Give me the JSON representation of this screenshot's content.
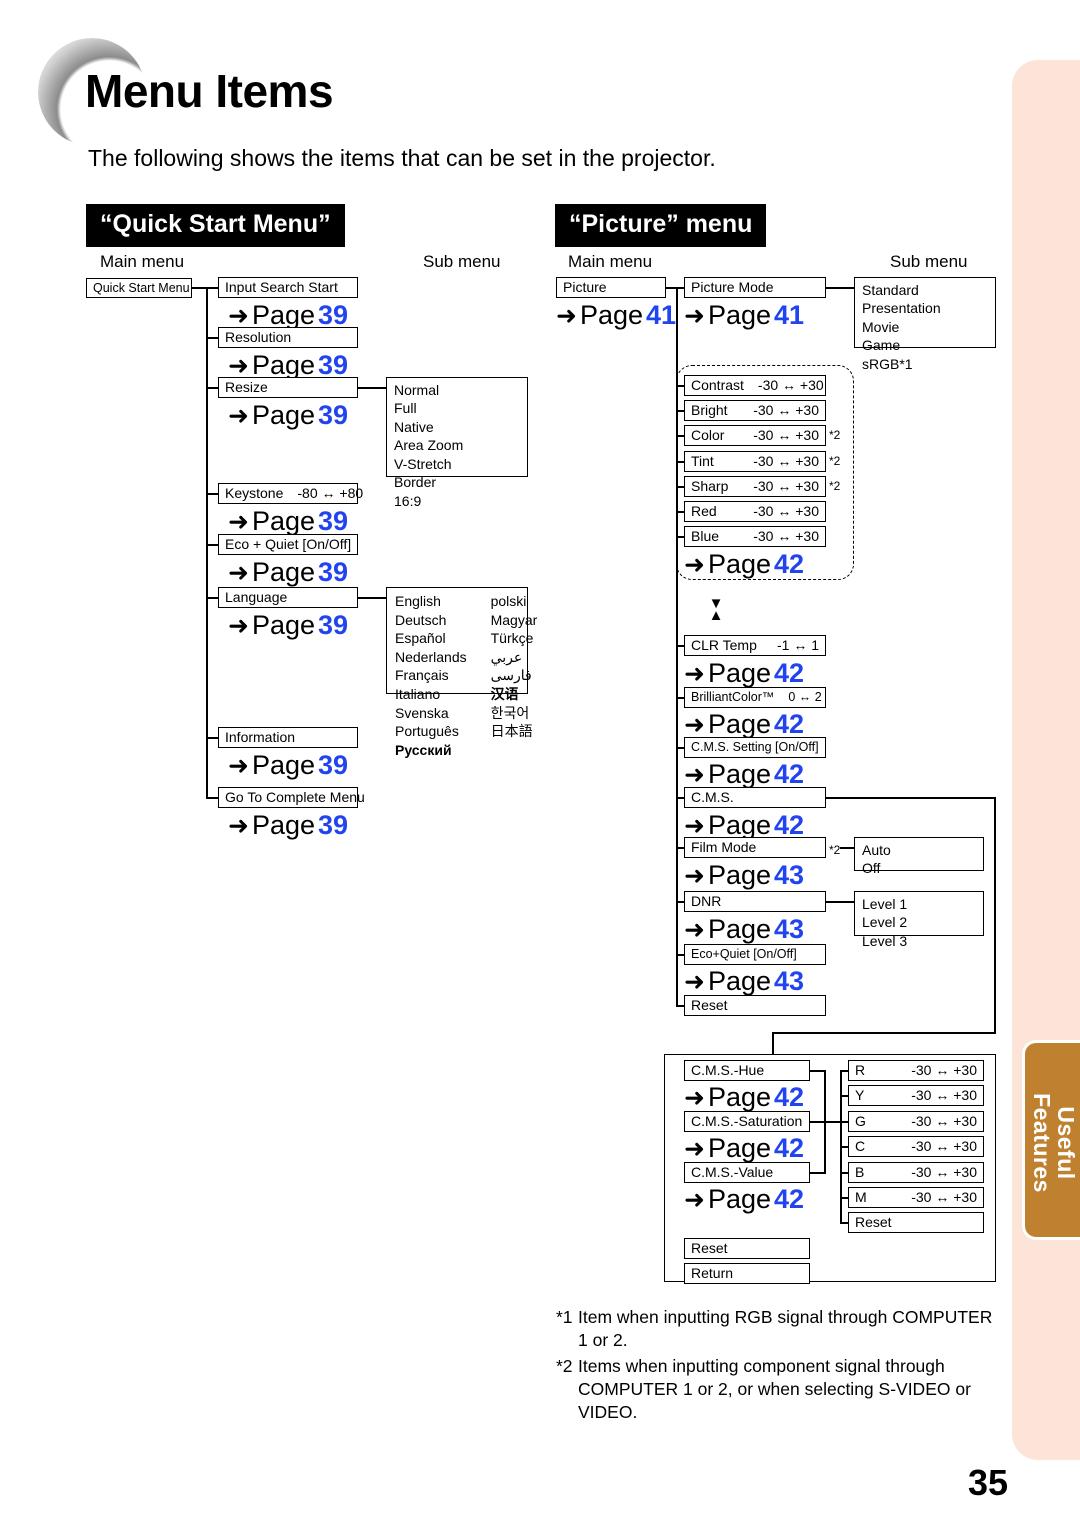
{
  "page": {
    "title": "Menu Items",
    "intro": "The following shows the items that can be set in the projector.",
    "number": "35",
    "side_tab": "Useful\nFeatures",
    "accent_blue": "#2244ee",
    "tab_color": "#bf8130",
    "panel_color": "#fce4d8"
  },
  "labels": {
    "main_menu": "Main menu",
    "sub_menu": "Sub menu",
    "arrow": "➜",
    "page_word": "Page",
    "range_arrow": "↔",
    "scroll_down": "▼",
    "scroll_up": "▲"
  },
  "quick_start": {
    "banner": "“Quick Start Menu”",
    "root": "Quick Start Menu",
    "root_page": "",
    "items": [
      {
        "label": "Input Search Start",
        "page": "39"
      },
      {
        "label": "Resolution",
        "page": "39"
      },
      {
        "label": "Resize",
        "page": "39"
      },
      {
        "label": "Keystone",
        "range": "-80 ↔ +80",
        "page": "39"
      },
      {
        "label": "Eco + Quiet [On/Off]",
        "page": "39"
      },
      {
        "label": "Language",
        "page": "39"
      },
      {
        "label": "Information",
        "page": "39"
      },
      {
        "label": "Go To Complete Menu",
        "page": "39"
      }
    ],
    "resize_options": [
      "Normal",
      "Full",
      "Native",
      "Area Zoom",
      "V-Stretch",
      "Border",
      "16:9"
    ],
    "language_options_left": [
      "English",
      "Deutsch",
      "Español",
      "Nederlands",
      "Français",
      "Italiano",
      "Svenska",
      "Português",
      "Русский"
    ],
    "language_options_right": [
      "polski",
      "Magyar",
      "Türkçe",
      "عربي",
      "فارسی",
      "汉语",
      "한국어",
      "日本語"
    ]
  },
  "picture": {
    "banner": "“Picture” menu",
    "root": "Picture",
    "root_page": "41",
    "picture_mode": {
      "label": "Picture Mode",
      "page": "41"
    },
    "picture_mode_options": [
      "Standard",
      "Presentation",
      "Movie",
      "Game",
      "sRGB*1"
    ],
    "adjust_group": {
      "page": "42",
      "items": [
        {
          "label": "Contrast",
          "range": "-30 ↔ +30",
          "note": ""
        },
        {
          "label": "Bright",
          "range": "-30 ↔ +30",
          "note": ""
        },
        {
          "label": "Color",
          "range": "-30 ↔ +30",
          "note": "*2"
        },
        {
          "label": "Tint",
          "range": "-30 ↔ +30",
          "note": "*2"
        },
        {
          "label": "Sharp",
          "range": "-30 ↔ +30",
          "note": "*2"
        },
        {
          "label": "Red",
          "range": "-30 ↔ +30",
          "note": ""
        },
        {
          "label": "Blue",
          "range": "-30 ↔ +30",
          "note": ""
        }
      ]
    },
    "lower_items": [
      {
        "label": "CLR Temp",
        "range": "-1 ↔ 1",
        "page": "42"
      },
      {
        "label": "BrilliantColor™",
        "range": "0 ↔ 2",
        "page": "42"
      },
      {
        "label": "C.M.S. Setting [On/Off]",
        "range": "",
        "page": "42"
      },
      {
        "label": "C.M.S.",
        "range": "",
        "page": "42"
      },
      {
        "label": "Film Mode",
        "range": "",
        "page": "43",
        "note": "*2"
      },
      {
        "label": "DNR",
        "range": "",
        "page": "43"
      },
      {
        "label": "Eco+Quiet [On/Off]",
        "range": "",
        "page": "43"
      },
      {
        "label": "Reset",
        "range": "",
        "page": ""
      }
    ],
    "film_mode_options": [
      "Auto",
      "Off"
    ],
    "dnr_options": [
      "Level 1",
      "Level 2",
      "Level 3"
    ],
    "cms_panel": {
      "items": [
        {
          "label": "C.M.S.-Hue",
          "page": "42"
        },
        {
          "label": "C.M.S.-Saturation",
          "page": "42"
        },
        {
          "label": "C.M.S.-Value",
          "page": "42"
        }
      ],
      "channels": [
        {
          "label": "R",
          "range": "-30 ↔ +30"
        },
        {
          "label": "Y",
          "range": "-30 ↔ +30"
        },
        {
          "label": "G",
          "range": "-30 ↔ +30"
        },
        {
          "label": "C",
          "range": "-30 ↔ +30"
        },
        {
          "label": "B",
          "range": "-30 ↔ +30"
        },
        {
          "label": "M",
          "range": "-30 ↔ +30"
        }
      ],
      "channel_reset": "Reset",
      "reset": "Reset",
      "return": "Return"
    }
  },
  "footnotes": [
    {
      "mark": "*1",
      "text": "Item when inputting RGB signal through COMPUTER 1 or 2."
    },
    {
      "mark": "*2",
      "text": "Items when inputting component signal through COMPUTER 1 or 2, or when selecting S-VIDEO or VIDEO."
    }
  ]
}
